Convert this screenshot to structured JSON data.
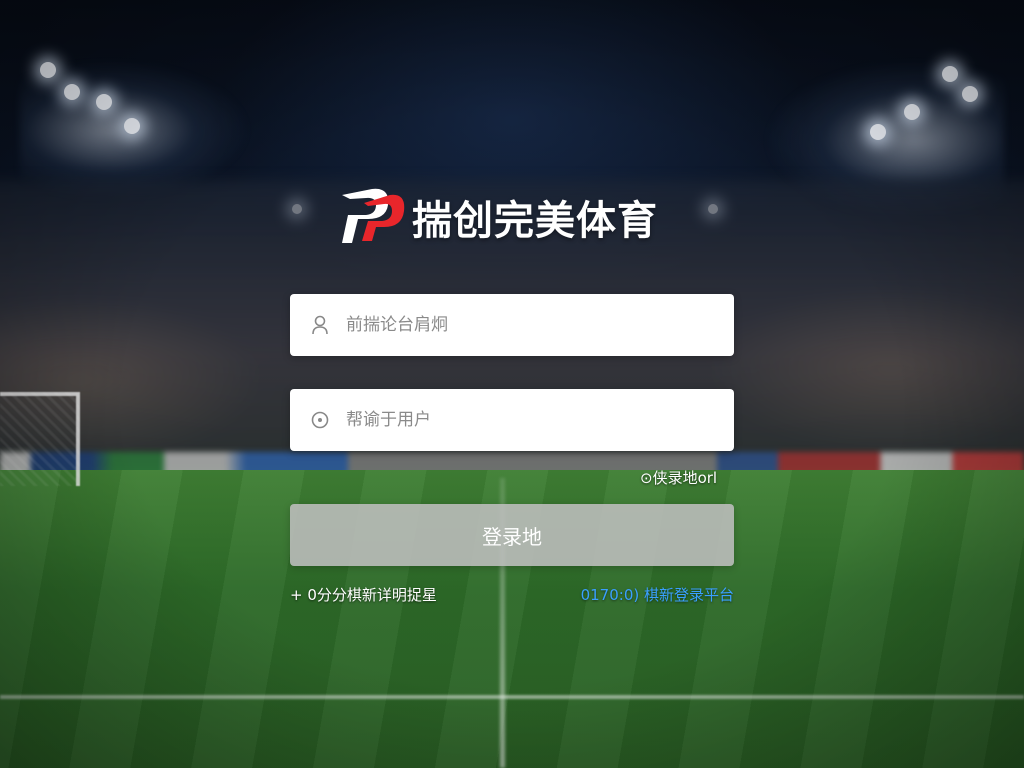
{
  "brand": {
    "name": "揣创完美体育",
    "logo_icon": "pp-logo-icon",
    "accent_color": "#e8262b"
  },
  "login_form": {
    "username_placeholder": "前揣论台肩炯",
    "username_icon": "user-icon",
    "password_placeholder": "帮谕于用户",
    "password_icon": "lock-icon",
    "forgot_label": "⊙侠录地orl",
    "submit_label": "登录地",
    "submit_color": "#bebebe",
    "footer_left": "+ 0分分棋新详明捉星",
    "footer_right": "0170:0) 棋新登录平台",
    "footer_right_color": "#3aa0ff"
  }
}
